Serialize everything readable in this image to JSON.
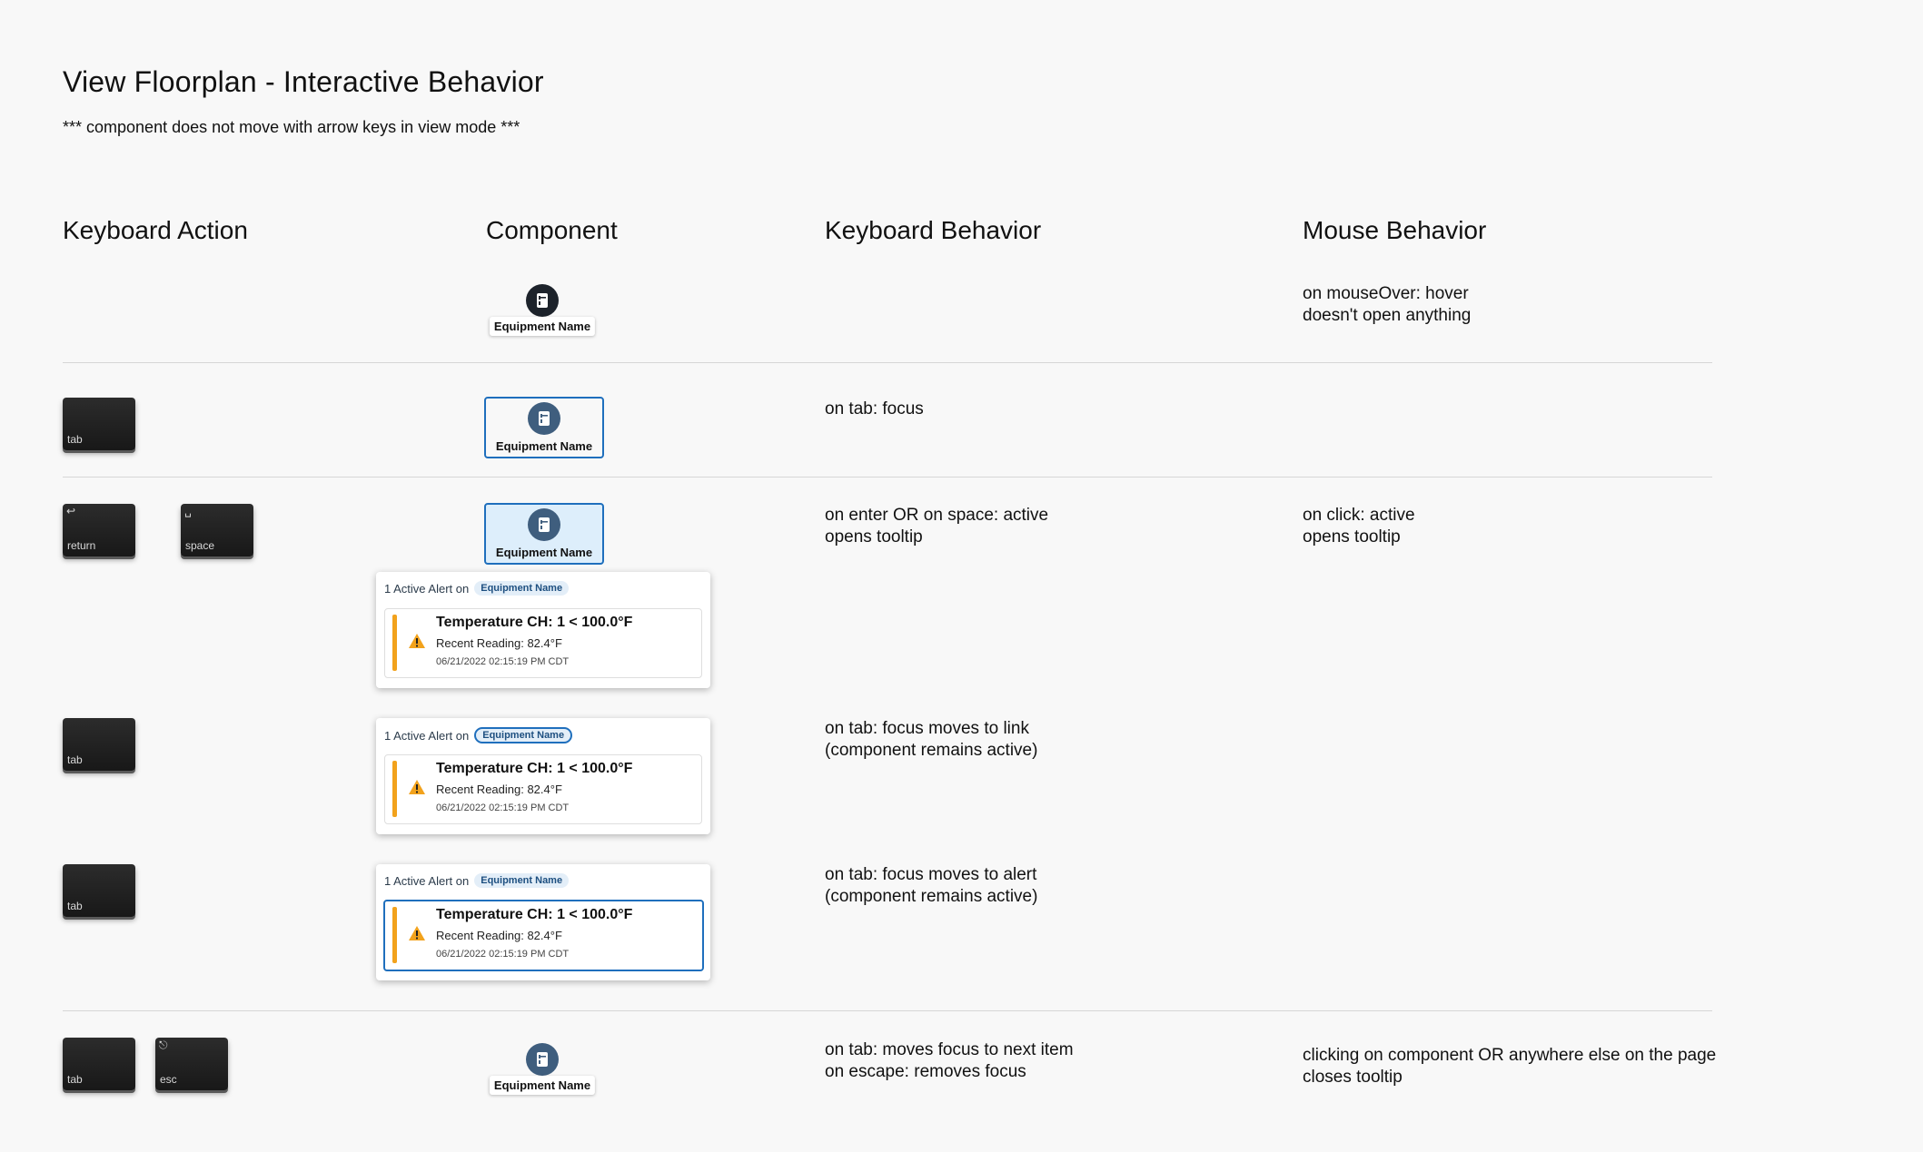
{
  "page": {
    "title": "View Floorplan - Interactive Behavior",
    "subtitle": "*** component does not move with arrow keys in view mode ***"
  },
  "columns": {
    "keyboard_action": "Keyboard Action",
    "component": "Component",
    "keyboard_behavior": "Keyboard Behavior",
    "mouse_behavior": "Mouse Behavior"
  },
  "keys": {
    "tab": "tab",
    "return": "return",
    "space": "space",
    "esc": "esc",
    "return_symbol": "↩",
    "space_symbol": "␣",
    "esc_symbol": "⎋"
  },
  "component": {
    "equipment_name": "Equipment Name",
    "icon": "equipment-icon"
  },
  "tooltip": {
    "alert_count": "1 Active Alert on",
    "alert_title": "Temperature CH: 1 < 100.0°F",
    "recent_reading": "Recent Reading: 82.4°F",
    "timestamp": "06/21/2022 02:15:19 PM CDT"
  },
  "rows": {
    "hover": {
      "mouse_line1": "on mouseOver: hover",
      "mouse_line2": "doesn't open anything"
    },
    "focus": {
      "keyboard_line1": "on tab: focus"
    },
    "active": {
      "keyboard_line1": "on enter OR on space: active",
      "keyboard_line2": "opens tooltip",
      "mouse_line1": "on click: active",
      "mouse_line2": "opens tooltip"
    },
    "link_focus": {
      "keyboard_line1": "on tab: focus moves to link",
      "keyboard_line2": "(component remains active)"
    },
    "alert_focus": {
      "keyboard_line1": "on tab: focus moves to alert",
      "keyboard_line2": "(component remains active)"
    },
    "close": {
      "keyboard_line1": "on tab: moves focus to next item",
      "keyboard_line2": "on escape: removes focus",
      "mouse_line1": "clicking on component OR anywhere else on the page",
      "mouse_line2": "closes tooltip"
    }
  },
  "colors": {
    "focus_blue": "#1f6fbd",
    "active_fill": "#ddeefb",
    "warning": "#f2a21c",
    "marker_dark": "#1d232b",
    "marker_blue": "#3f5e7e"
  }
}
